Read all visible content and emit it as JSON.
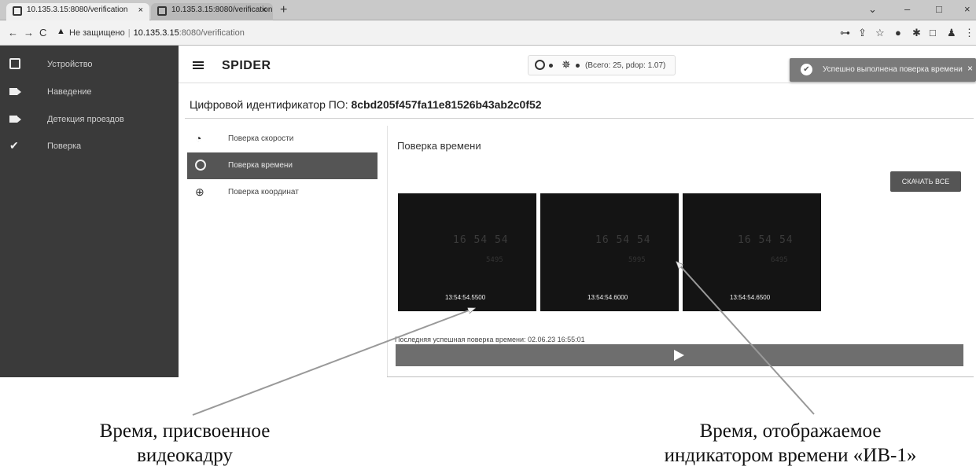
{
  "browser": {
    "tabs": [
      {
        "title": "10.135.3.15:8080/verification",
        "close": "×"
      },
      {
        "title": "10.135.3.15:8080/verification",
        "close": "×"
      }
    ],
    "new_tab": "+",
    "window_controls": [
      "⌄",
      "–",
      "□",
      "×"
    ],
    "nav": {
      "back": "←",
      "forward": "→",
      "reload": "C"
    },
    "security_warning": "Не защищено",
    "url_host": "10.135.3.15",
    "url_path": ":8080/verification",
    "extension_icons": [
      "⊶",
      "⇪",
      "☆",
      "●",
      "✱",
      "□",
      "♟",
      "⋮"
    ]
  },
  "sidebar": {
    "items": [
      {
        "label": "Устройство",
        "icon": "monitor-icon"
      },
      {
        "label": "Наведение",
        "icon": "camera-icon"
      },
      {
        "label": "Детекция проездов",
        "icon": "camera-icon"
      },
      {
        "label": "Поверка",
        "icon": "check-icon"
      }
    ]
  },
  "header": {
    "brand": "SPIDER",
    "status_text": "(Всего: 25, pdop: 1.07)"
  },
  "toast": {
    "message": "Успешно выполнена поверка времени",
    "close": "×"
  },
  "identifier": {
    "label": "Цифровой идентификатор ПО:",
    "value": "8cbd205f457fa11e81526b43ab2c0f52"
  },
  "subnav": [
    {
      "label": "Поверка скорости",
      "icon": "speedometer-icon",
      "active": false
    },
    {
      "label": "Поверка времени",
      "icon": "clock-icon",
      "active": true
    },
    {
      "label": "Поверка координат",
      "icon": "globe-icon",
      "active": false
    }
  ],
  "main": {
    "section_title": "Поверка времени",
    "download_label": "СКАЧАТЬ ВСЕ",
    "frames": [
      {
        "display": "16 54 54",
        "sub": "5495",
        "timestamp": "13:54:54.5500"
      },
      {
        "display": "16 54 54",
        "sub": "5995",
        "timestamp": "13:54:54.6000"
      },
      {
        "display": "16 54 54",
        "sub": "6495",
        "timestamp": "13:54:54.6500"
      }
    ],
    "last_check": "Последняя успешная поверка времени: 02.06.23 16:55:01"
  },
  "captions": {
    "left": [
      "Время, присвоенное",
      "видеокадру"
    ],
    "right": [
      "Время, отображаемое",
      "индикатором времени «ИВ-1»"
    ]
  }
}
